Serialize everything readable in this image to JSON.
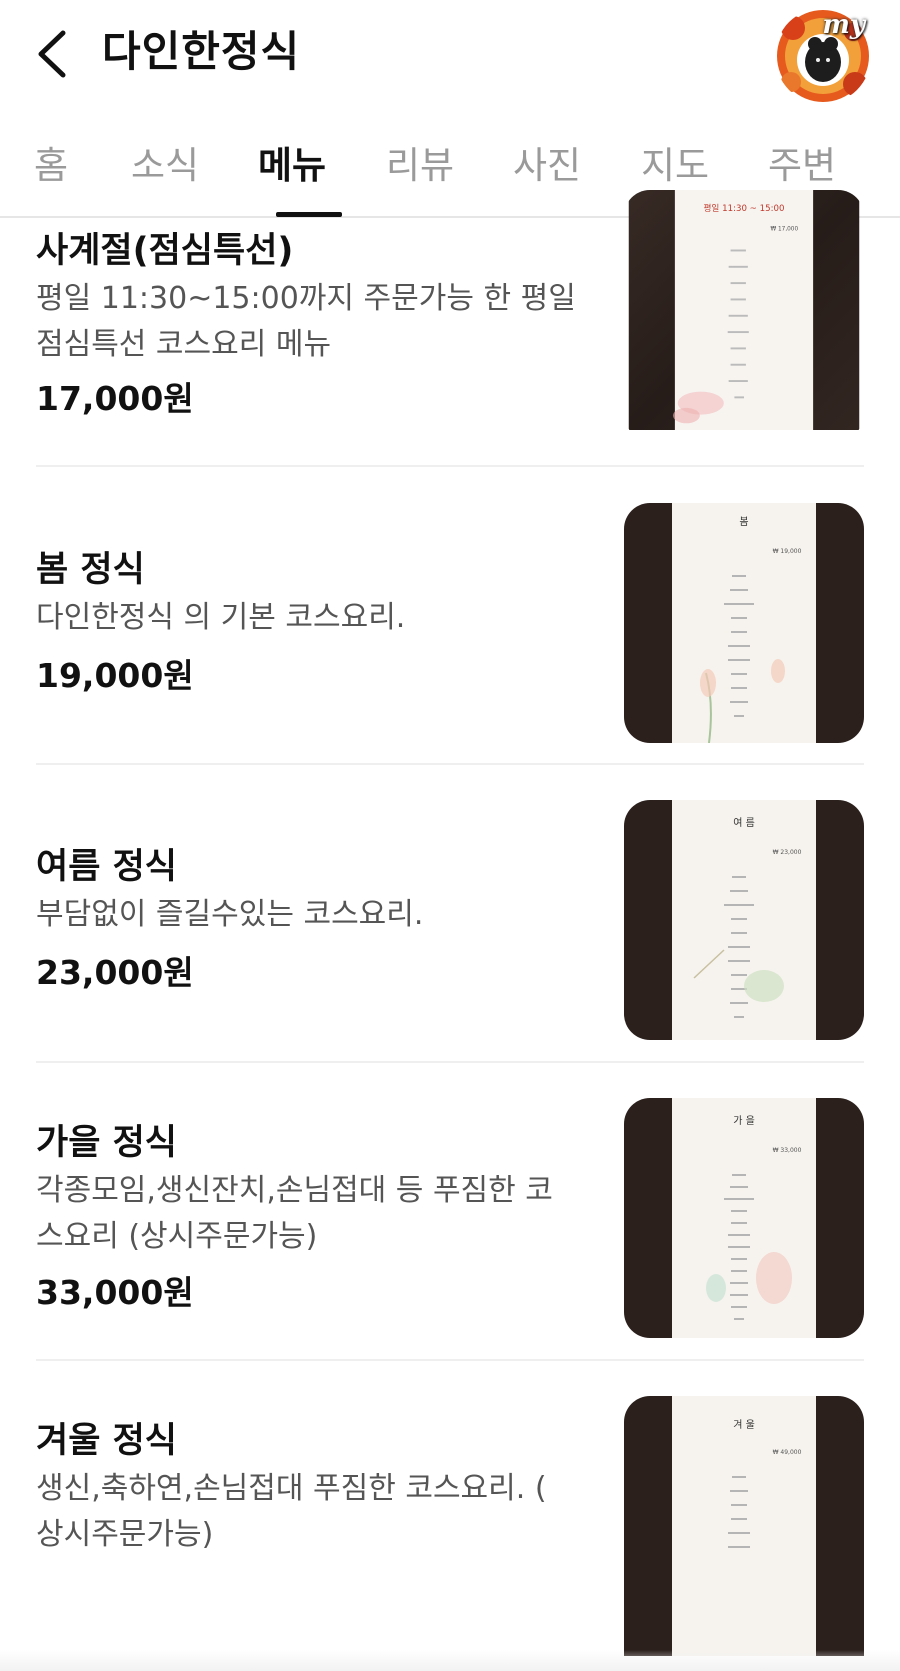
{
  "header": {
    "title": "다인한정식",
    "back_icon": "chevron-left-icon",
    "avatar_text": "my"
  },
  "tabs": [
    {
      "label": "홈",
      "active": false
    },
    {
      "label": "소식",
      "active": false
    },
    {
      "label": "메뉴",
      "active": true
    },
    {
      "label": "리뷰",
      "active": false
    },
    {
      "label": "사진",
      "active": false
    },
    {
      "label": "지도",
      "active": false
    },
    {
      "label": "주변",
      "active": false
    }
  ],
  "menu": [
    {
      "name": "사계절(점심특선)",
      "description": "평일 11:30~15:00까지 주문가능 한 평일 점심특선 코스요리 메뉴",
      "price": "17,000원",
      "thumb_heading": "평일 11:30 ~ 15:00",
      "thumb_price": "₩ 17,000"
    },
    {
      "name": "봄 정식",
      "description": "다인한정식 의 기본 코스요리.",
      "price": "19,000원",
      "thumb_heading": "봄",
      "thumb_price": "₩ 19,000"
    },
    {
      "name": "여름 정식",
      "description": "부담없이 즐길수있는 코스요리.",
      "price": "23,000원",
      "thumb_heading": "여 름",
      "thumb_price": "₩ 23,000"
    },
    {
      "name": "가을 정식",
      "description": "각종모임,생신잔치,손님접대 등 푸짐한 코스요리 (상시주문가능)",
      "price": "33,000원",
      "thumb_heading": "가 을",
      "thumb_price": "₩ 33,000"
    },
    {
      "name": "겨울 정식",
      "description": "생신,축하연,손님접대 푸짐한 코스요리. ( 상시주문가능)",
      "price": "",
      "thumb_heading": "겨 울",
      "thumb_price": "₩ 49,000"
    }
  ],
  "colors": {
    "accent": "#111111",
    "tab_inactive": "#9a9a9a",
    "description": "#555555",
    "divider": "#efefef",
    "table_wood": "#2b201c"
  }
}
